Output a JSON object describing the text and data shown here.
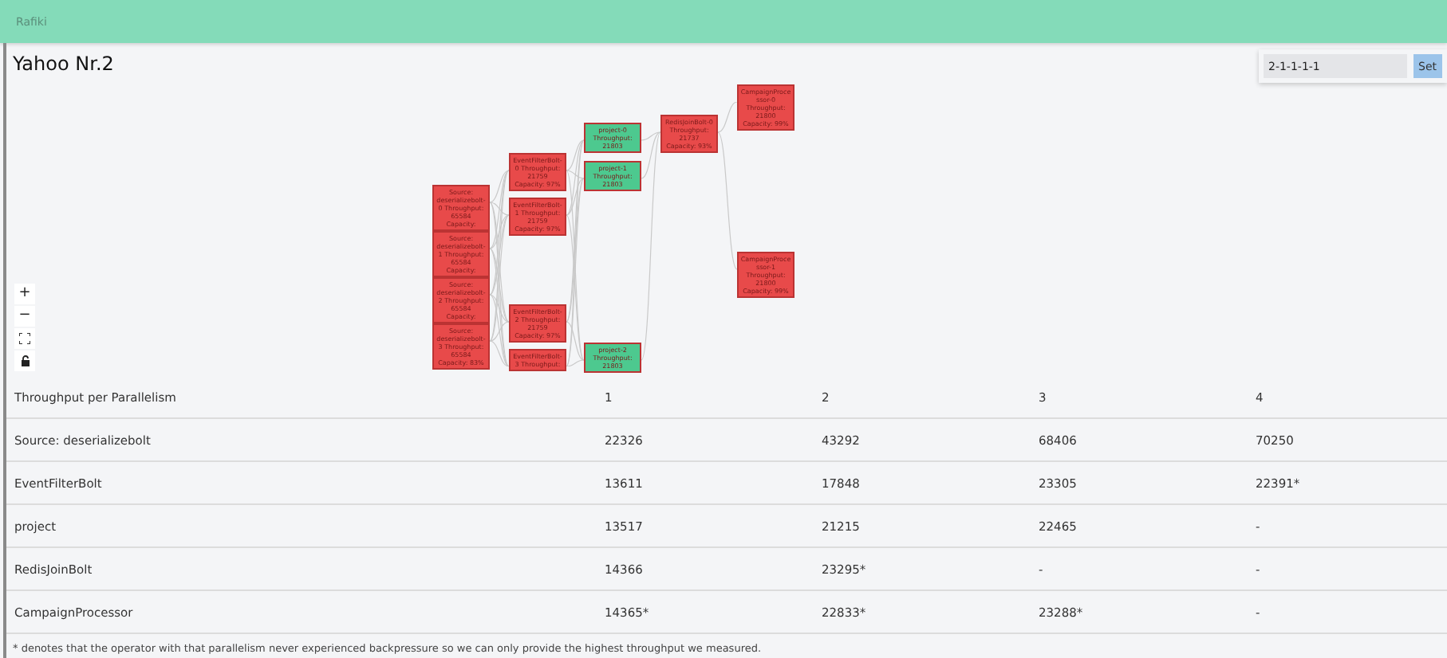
{
  "app_bar": {
    "title": "Rafiki"
  },
  "page_title": "Yahoo Nr.2",
  "parallelism_form": {
    "value": "2-1-1-1-1",
    "button": "Set"
  },
  "graph": {
    "columns": [
      [
        {
          "label": "Source: deserializebolt-0 Throughput: 65584 Capacity:",
          "color": "#e84a4a"
        },
        {
          "label": "Source: deserializebolt-1 Throughput: 65584 Capacity:",
          "color": "#e84a4a"
        },
        {
          "label": "Source: deserializebolt-2 Throughput: 65584 Capacity:",
          "color": "#e84a4a"
        },
        {
          "label": "Source: deserializebolt-3 Throughput: 65584 Capacity: 83%",
          "color": "#e84a4a"
        }
      ],
      [
        {
          "label": "EventFilterBolt-0 Throughput: 21759 Capacity: 97%",
          "color": "#e84a4a"
        },
        {
          "label": "EventFilterBolt-1 Throughput: 21759 Capacity: 97%",
          "color": "#e84a4a"
        },
        {
          "label": "EventFilterBolt-2 Throughput: 21759 Capacity: 97%",
          "color": "#e84a4a"
        },
        {
          "label": "EventFilterBolt-3 Throughput:",
          "color": "#e84a4a"
        }
      ],
      [
        {
          "label": "project-0 Throughput: 21803",
          "color": "#4dc98f"
        },
        {
          "label": "project-1 Throughput: 21803",
          "color": "#4dc98f"
        },
        {
          "label": "project-2 Throughput: 21803",
          "color": "#4dc98f"
        }
      ],
      [
        {
          "label": "RedisJoinBolt-0 Throughput: 21737 Capacity: 93%",
          "color": "#e84a4a"
        }
      ],
      [
        {
          "label": "CampaignProcessor-0 Throughput: 21800 Capacity: 99%",
          "color": "#e84a4a"
        },
        {
          "label": "CampaignProcessor-1 Throughput: 21800 Capacity: 99%",
          "color": "#e84a4a"
        }
      ]
    ],
    "zoom_controls": [
      "+",
      "−"
    ]
  },
  "table": {
    "columns": [
      "Throughput per Parallelism",
      "1",
      "2",
      "3",
      "4"
    ],
    "rows": [
      [
        "Source: deserializebolt",
        "22326",
        "43292",
        "68406",
        "70250"
      ],
      [
        "EventFilterBolt",
        "13611",
        "17848",
        "23305",
        "22391*"
      ],
      [
        "project",
        "13517",
        "21215",
        "22465",
        "-"
      ],
      [
        "RedisJoinBolt",
        "14366",
        "23295*",
        "-",
        "-"
      ],
      [
        "CampaignProcessor",
        "14365*",
        "22833*",
        "23288*",
        "-"
      ]
    ]
  },
  "footnote": "* denotes that the operator with that parallelism never experienced backpressure so we can only provide the highest throughput we measured."
}
